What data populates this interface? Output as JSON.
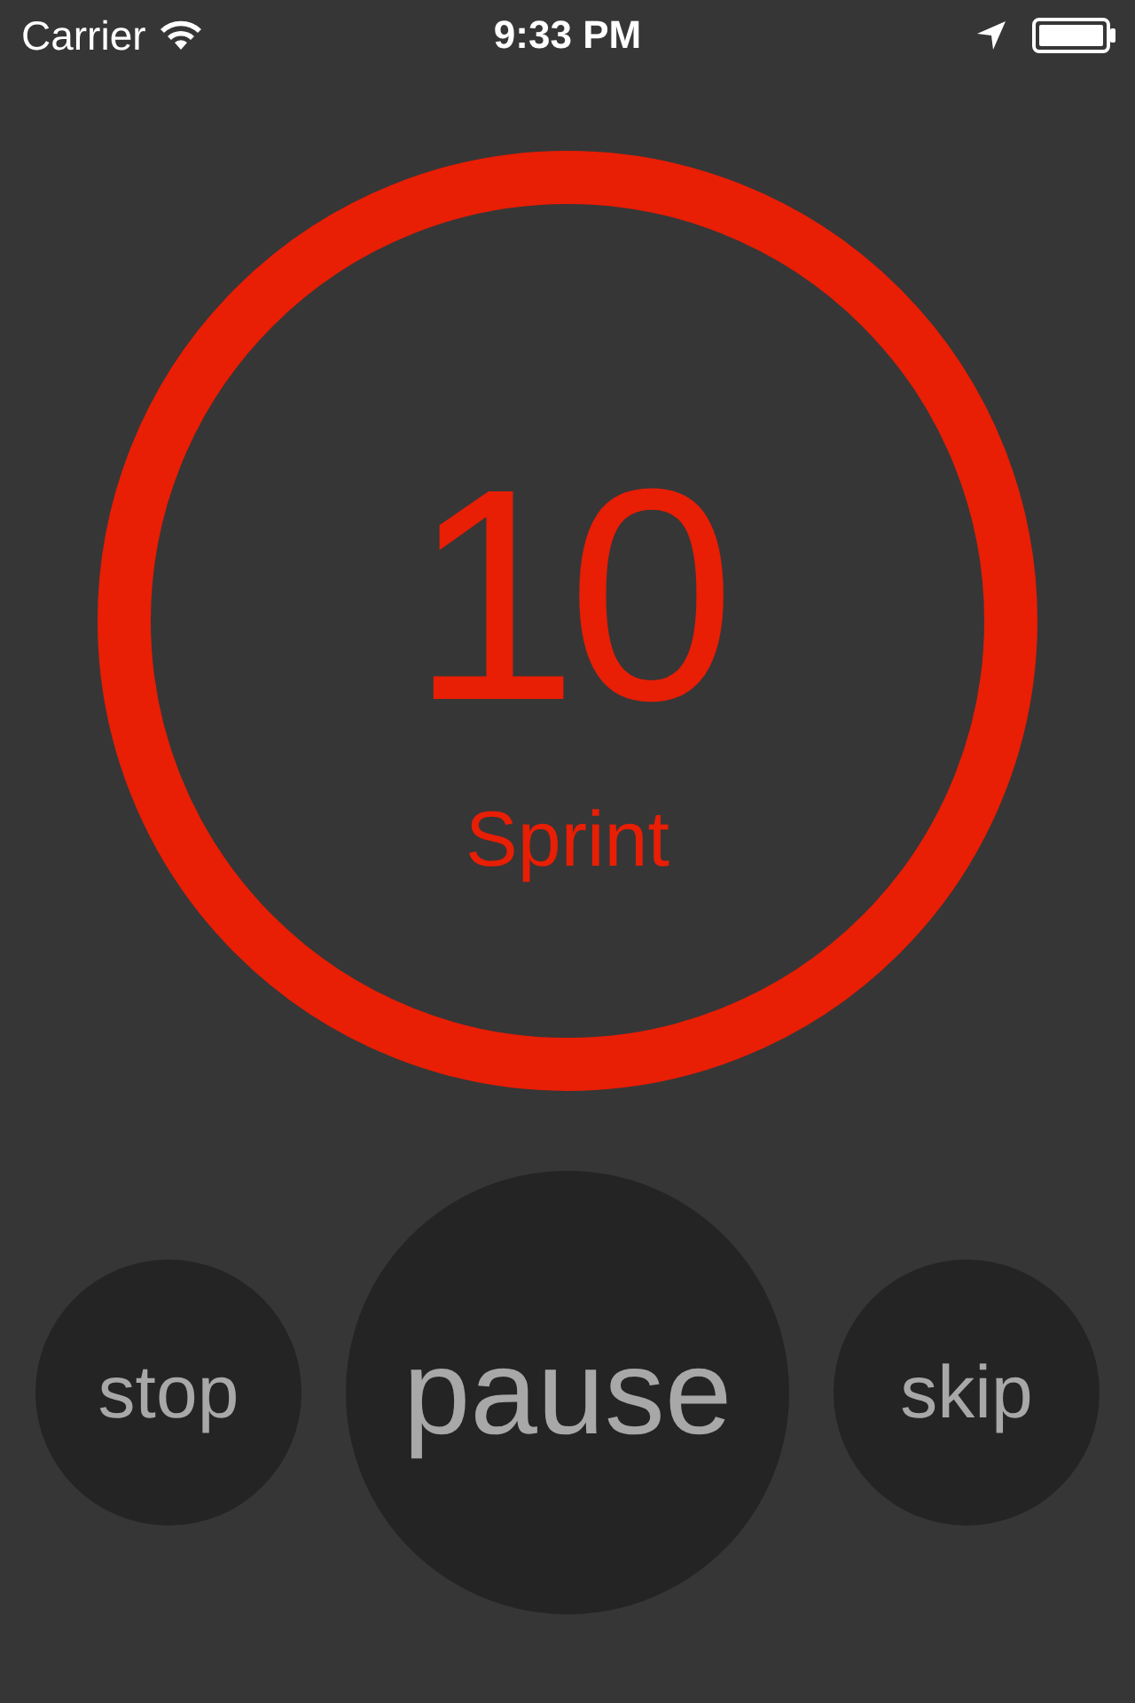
{
  "status_bar": {
    "carrier": "Carrier",
    "time": "9:33 PM"
  },
  "timer": {
    "count": "10",
    "phase": "Sprint"
  },
  "buttons": [
    {
      "label": "stop",
      "kind": "small"
    },
    {
      "label": "pause",
      "kind": "large"
    },
    {
      "label": "skip",
      "kind": "small"
    }
  ]
}
